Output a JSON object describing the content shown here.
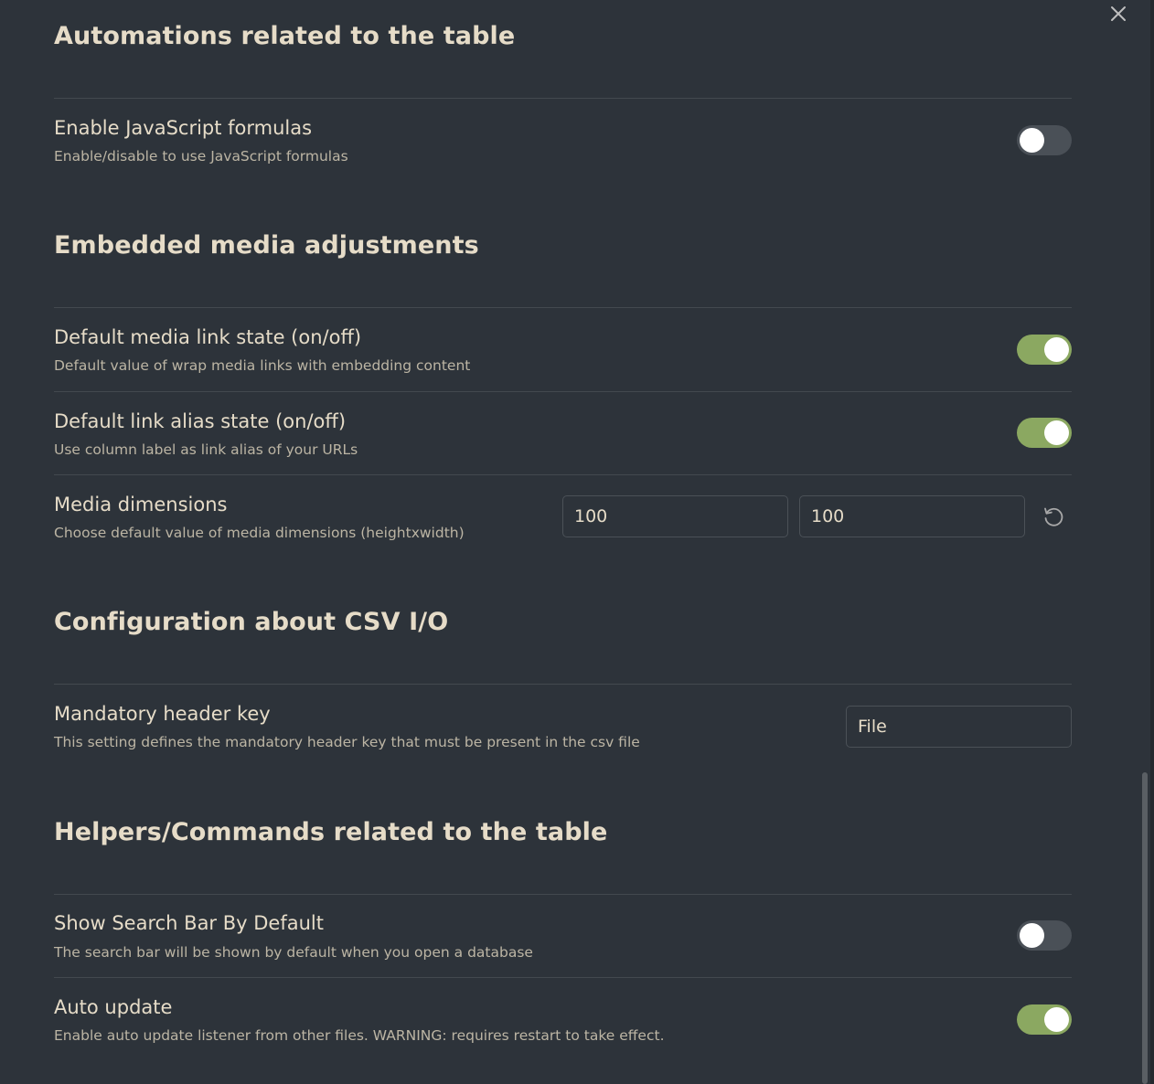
{
  "close": {
    "icon": "close-icon"
  },
  "sections": {
    "automations": {
      "title": "Automations related to the table",
      "settings": [
        {
          "name": "Enable JavaScript formulas",
          "desc": "Enable/disable to use JavaScript formulas",
          "toggle": "off"
        }
      ]
    },
    "media": {
      "title": "Embedded media adjustments",
      "settings": [
        {
          "name": "Default media link state (on/off)",
          "desc": "Default value of wrap media links with embedding content",
          "toggle": "on"
        },
        {
          "name": "Default link alias state (on/off)",
          "desc": "Use column label as link alias of your URLs",
          "toggle": "on"
        },
        {
          "name": "Media dimensions",
          "desc": "Choose default value of media dimensions (heightxwidth)",
          "height_value": "100",
          "width_value": "100",
          "reset_icon": "reset-icon"
        }
      ]
    },
    "csv": {
      "title": "Configuration about CSV I/O",
      "settings": [
        {
          "name": "Mandatory header key",
          "desc": "This setting defines the mandatory header key that must be present in the csv file",
          "value": "File"
        }
      ]
    },
    "helpers": {
      "title": "Helpers/Commands related to the table",
      "settings": [
        {
          "name": "Show Search Bar By Default",
          "desc": "The search bar will be shown by default when you open a database",
          "toggle": "off"
        },
        {
          "name": "Auto update",
          "desc": "Enable auto update listener from other files. WARNING: requires restart to take effect.",
          "toggle": "on"
        }
      ]
    }
  },
  "colors": {
    "background": "#2d333a",
    "heading_text": "#e6dcc8",
    "desc_text": "#bcb5a4",
    "toggle_on": "#8ba861",
    "toggle_off": "#4a5057",
    "divider": "#43494f"
  }
}
